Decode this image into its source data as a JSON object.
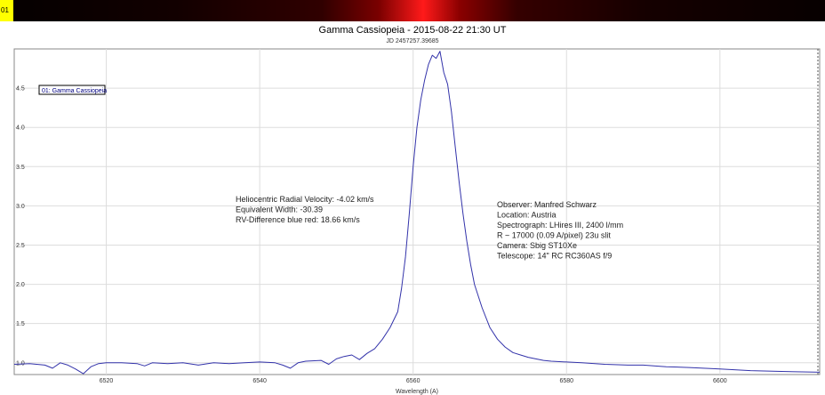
{
  "strip_label": "01",
  "chart_data": {
    "type": "line",
    "title": "Gamma Cassiopeia - 2015-08-22 21:30 UT",
    "subtitle": "JD 2457257.39685",
    "xlabel": "Wavelength (A)",
    "ylabel": "",
    "xlim": [
      6508,
      6613
    ],
    "ylim": [
      0.85,
      5.0
    ],
    "x_ticks": [
      6520,
      6540,
      6560,
      6580,
      6600
    ],
    "y_ticks": [
      1.0,
      1.5,
      2.0,
      2.5,
      3.0,
      3.5,
      4.0,
      4.5
    ],
    "y_tick_labels": [
      "1.0",
      "1.5",
      "2.0",
      "2.5",
      "3.0",
      "3.5",
      "4.0",
      "4.5"
    ],
    "legend": {
      "placement": "top-left",
      "entries": [
        "01: Gamma Cassiopeia"
      ]
    },
    "series": [
      {
        "name": "01: Gamma Cassiopeia",
        "color": "#3333aa",
        "x": [
          6508,
          6510,
          6512,
          6513,
          6514,
          6515,
          6516,
          6517,
          6518,
          6519,
          6520,
          6522,
          6524,
          6525,
          6526,
          6528,
          6530,
          6532,
          6534,
          6536,
          6538,
          6540,
          6542,
          6543,
          6544,
          6545,
          6546,
          6548,
          6549,
          6550,
          6551,
          6552,
          6553,
          6554,
          6555,
          6556,
          6557,
          6558,
          6558.5,
          6559,
          6559.5,
          6560,
          6560.5,
          6561,
          6561.5,
          6562,
          6562.5,
          6563,
          6563.5,
          6564,
          6564.5,
          6565,
          6565.5,
          6566,
          6566.5,
          6567,
          6567.5,
          6568,
          6569,
          6570,
          6571,
          6572,
          6573,
          6574,
          6575,
          6576,
          6577,
          6578,
          6580,
          6582,
          6585,
          6588,
          6590,
          6593,
          6596,
          6600,
          6604,
          6608,
          6613
        ],
        "y": [
          0.98,
          0.99,
          0.97,
          0.93,
          1.0,
          0.97,
          0.92,
          0.86,
          0.95,
          0.99,
          1.0,
          1.0,
          0.99,
          0.96,
          1.0,
          0.99,
          1.0,
          0.97,
          1.0,
          0.99,
          1.0,
          1.01,
          1.0,
          0.97,
          0.93,
          1.0,
          1.02,
          1.03,
          0.98,
          1.05,
          1.08,
          1.1,
          1.04,
          1.12,
          1.18,
          1.3,
          1.45,
          1.65,
          1.95,
          2.35,
          2.9,
          3.5,
          4.0,
          4.35,
          4.6,
          4.8,
          4.92,
          4.88,
          4.97,
          4.7,
          4.55,
          4.2,
          3.75,
          3.3,
          2.9,
          2.55,
          2.25,
          2.0,
          1.7,
          1.45,
          1.3,
          1.2,
          1.13,
          1.1,
          1.07,
          1.05,
          1.03,
          1.02,
          1.01,
          1.0,
          0.98,
          0.97,
          0.97,
          0.95,
          0.94,
          0.92,
          0.9,
          0.89,
          0.88
        ]
      }
    ],
    "annotations": {
      "left": [
        "Heliocentric Radial Velocity: -4.02 km/s",
        "Equivalent Width: -30.39",
        "RV-Difference blue red: 18.66 km/s"
      ],
      "right": [
        "Observer: Manfred Schwarz",
        "Location: Austria",
        "Spectrograph: LHires III, 2400 l/mm",
        "R ~ 17000 (0.09 A/pixel) 23u slit",
        "Camera: Sbig ST10Xe",
        "Telescope: 14\" RC RC360AS f/9"
      ]
    }
  }
}
